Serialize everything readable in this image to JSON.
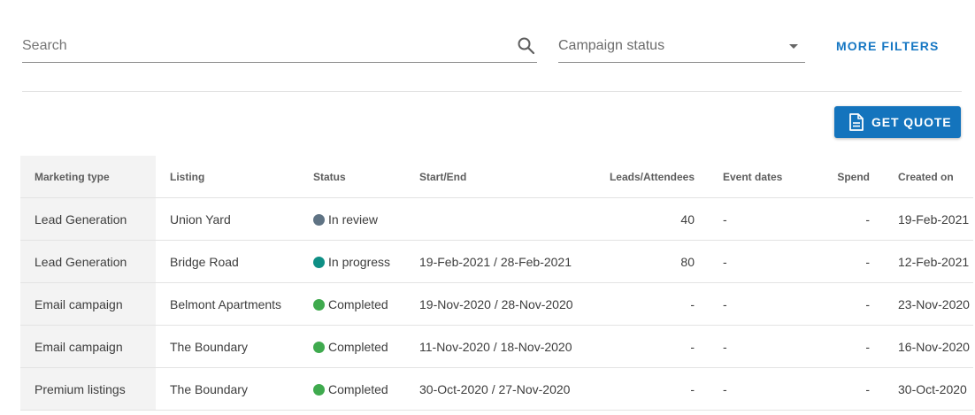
{
  "search": {
    "placeholder": "Search",
    "value": ""
  },
  "campaign_status_filter": {
    "label": "Campaign status"
  },
  "more_filters_label": "MORE FILTERS",
  "get_quote_label": "GET QUOTE",
  "table": {
    "columns": {
      "marketing_type": "Marketing type",
      "listing": "Listing",
      "status": "Status",
      "start_end": "Start/End",
      "leads_attendees": "Leads/Attendees",
      "event_dates": "Event dates",
      "spend": "Spend",
      "created_on": "Created on"
    },
    "rows": [
      {
        "marketing_type": "Lead Generation",
        "listing": "Union Yard",
        "status": "In review",
        "status_color": "#5f7384",
        "start_end": "",
        "leads_attendees": "40",
        "event_dates": "-",
        "spend": "-",
        "created_on": "19-Feb-2021"
      },
      {
        "marketing_type": "Lead Generation",
        "listing": "Bridge Road",
        "status": "In progress",
        "status_color": "#0e8f85",
        "start_end": "19-Feb-2021 / 28-Feb-2021",
        "leads_attendees": "80",
        "event_dates": "-",
        "spend": "-",
        "created_on": "12-Feb-2021"
      },
      {
        "marketing_type": "Email campaign",
        "listing": "Belmont Apartments",
        "status": "Completed",
        "status_color": "#3faa4e",
        "start_end": "19-Nov-2020 / 28-Nov-2020",
        "leads_attendees": "-",
        "event_dates": "-",
        "spend": "-",
        "created_on": "23-Nov-2020"
      },
      {
        "marketing_type": "Email campaign",
        "listing": "The Boundary",
        "status": "Completed",
        "status_color": "#3faa4e",
        "start_end": "11-Nov-2020 / 18-Nov-2020",
        "leads_attendees": "-",
        "event_dates": "-",
        "spend": "-",
        "created_on": "16-Nov-2020"
      },
      {
        "marketing_type": "Premium listings",
        "listing": "The Boundary",
        "status": "Completed",
        "status_color": "#3faa4e",
        "start_end": "30-Oct-2020 / 27-Nov-2020",
        "leads_attendees": "-",
        "event_dates": "-",
        "spend": "-",
        "created_on": "30-Oct-2020"
      }
    ]
  },
  "colors": {
    "accent": "#1474bd",
    "link": "#1677c3"
  },
  "icons": {
    "search": "search-icon",
    "dropdown": "caret-down-icon",
    "quote": "document-icon"
  }
}
